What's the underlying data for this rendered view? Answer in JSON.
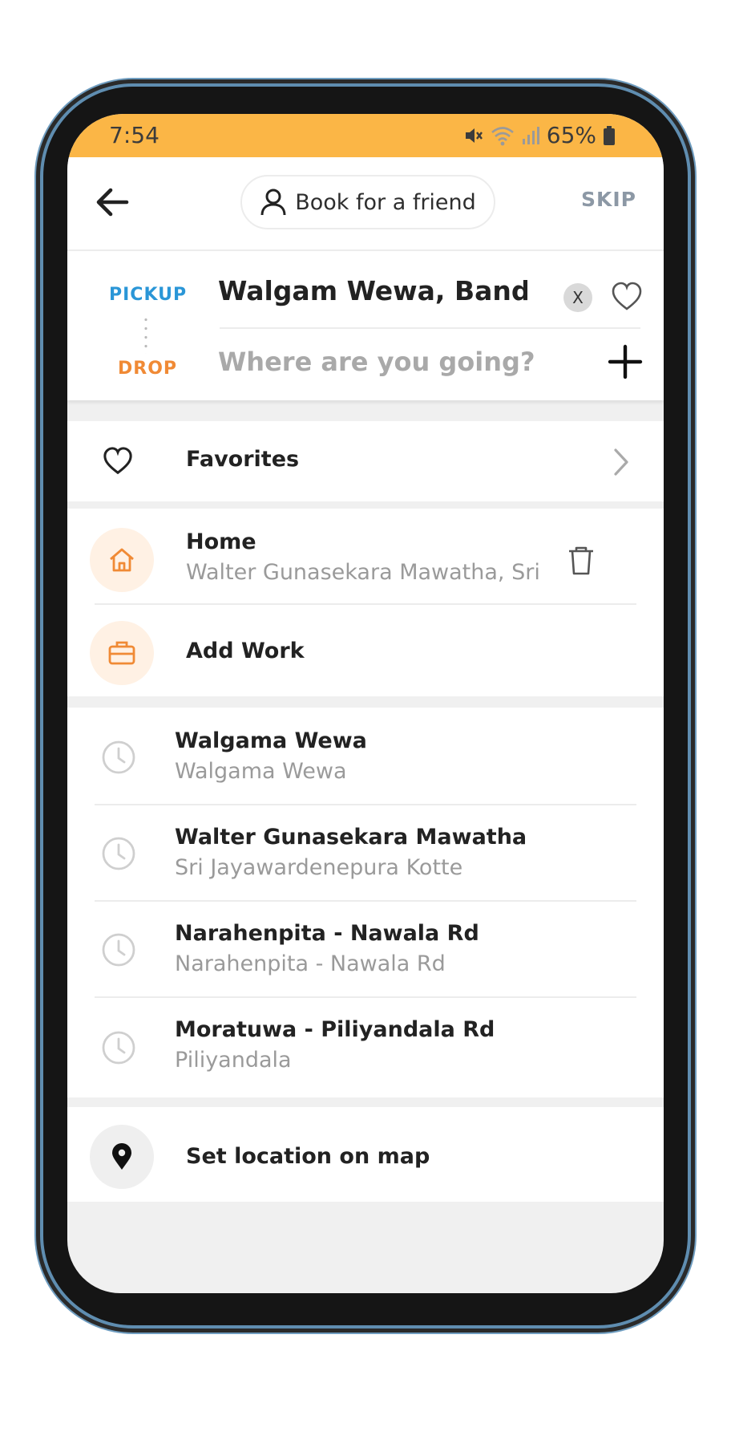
{
  "status_bar": {
    "time": "7:54",
    "battery": "65%"
  },
  "header": {
    "book_for_friend": "Book for a friend",
    "skip": "SKIP"
  },
  "route": {
    "pickup_label": "PICKUP",
    "pickup_value": "Walgam Wewa, Bandaragama",
    "clear_label": "X",
    "drop_label": "DROP",
    "drop_placeholder": "Where are you going?",
    "drop_value": ""
  },
  "favorites": {
    "label": "Favorites"
  },
  "saved_places": {
    "home": {
      "title": "Home",
      "address": "Walter Gunasekara Mawatha, Sri"
    },
    "work": {
      "title": "Add Work"
    }
  },
  "recent": [
    {
      "title": "Walgama Wewa",
      "subtitle": "Walgama Wewa"
    },
    {
      "title": "Walter Gunasekara Mawatha",
      "subtitle": "Sri Jayawardenepura Kotte"
    },
    {
      "title": "Narahenpita - Nawala Rd",
      "subtitle": "Narahenpita - Nawala Rd"
    },
    {
      "title": "Moratuwa - Piliyandala Rd",
      "subtitle": "Piliyandala"
    }
  ],
  "map_option": {
    "label": "Set location on map"
  },
  "colors": {
    "status_bar": "#fbb646",
    "pickup": "#2a96d7",
    "drop": "#f08a35",
    "accent_soft": "#fff1e4"
  },
  "icons": [
    "back-arrow-icon",
    "person-icon",
    "heart-icon",
    "plus-icon",
    "chevron-right-icon",
    "home-icon",
    "trash-icon",
    "briefcase-icon",
    "clock-icon",
    "location-pin-icon",
    "wifi-icon",
    "signal-icon",
    "battery-icon",
    "mute-icon"
  ]
}
